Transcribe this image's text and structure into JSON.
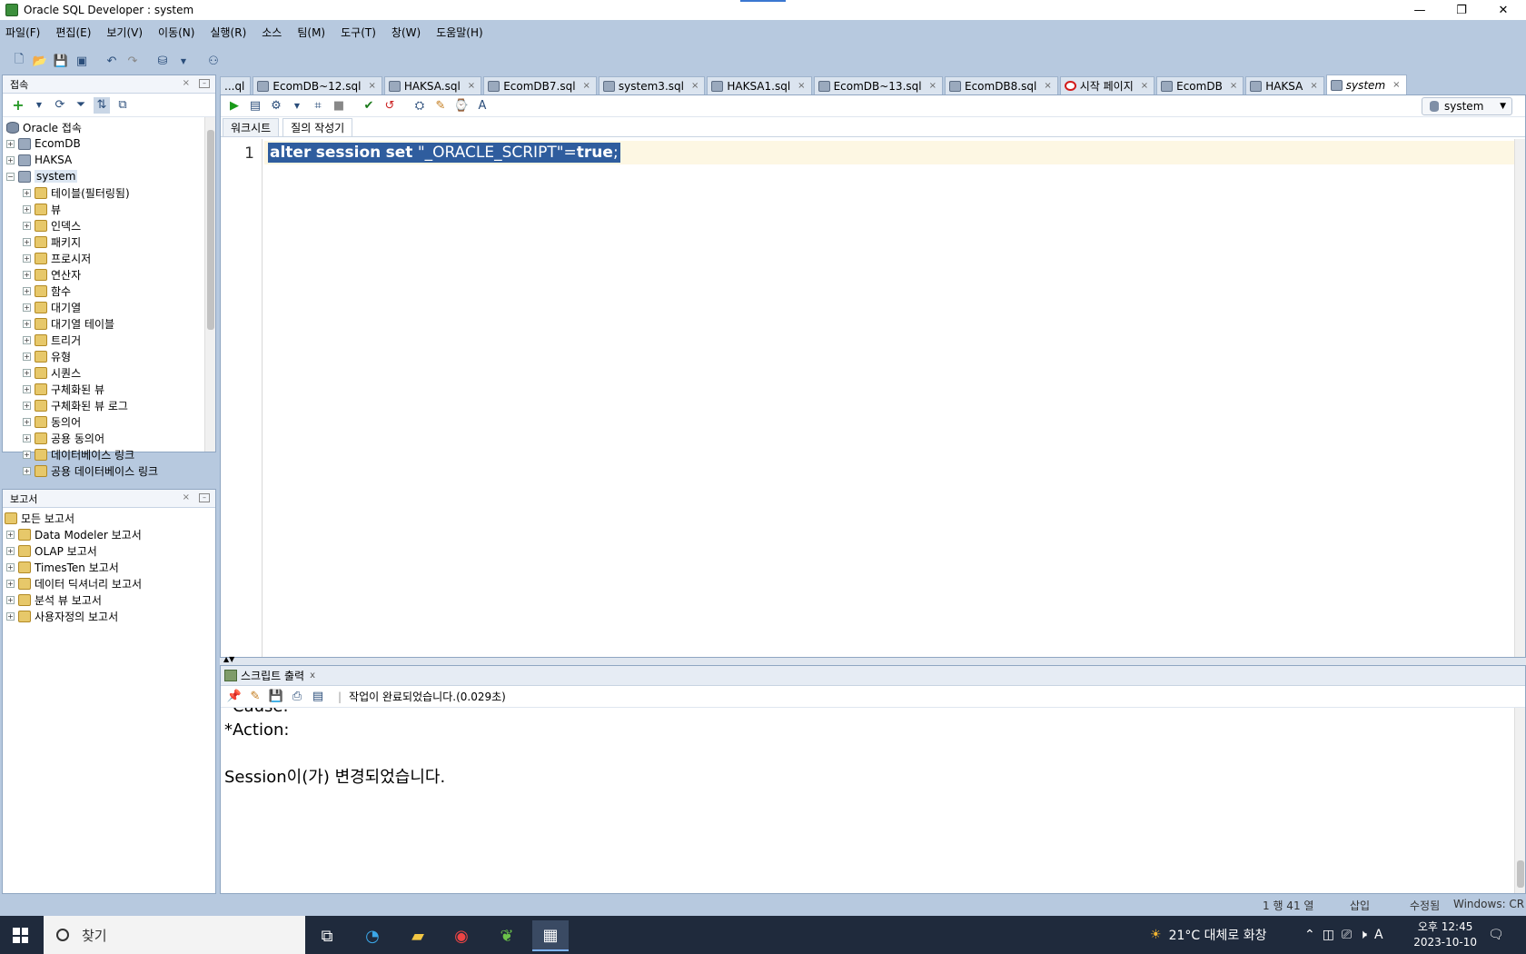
{
  "window": {
    "title": "Oracle SQL Developer : system",
    "controls": {
      "minimize": "—",
      "maximize": "❐",
      "close": "✕"
    }
  },
  "menu": [
    "파일(F)",
    "편집(E)",
    "보기(V)",
    "이동(N)",
    "실행(R)",
    "소스",
    "팀(M)",
    "도구(T)",
    "창(W)",
    "도움말(H)"
  ],
  "connections_panel": {
    "title": "접속",
    "root": "Oracle 접속",
    "items": [
      "EcomDB",
      "HAKSA",
      "system"
    ],
    "system_children": [
      "테이블(필터링됨)",
      "뷰",
      "인덱스",
      "패키지",
      "프로시저",
      "연산자",
      "함수",
      "대기열",
      "대기열 테이블",
      "트리거",
      "유형",
      "시퀀스",
      "구체화된 뷰",
      "구체화된 뷰 로그",
      "동의어",
      "공용 동의어",
      "데이터베이스 링크",
      "공용 데이터베이스 링크"
    ]
  },
  "reports_panel": {
    "title": "보고서",
    "root": "모든 보고서",
    "items": [
      "Data Modeler 보고서",
      "OLAP 보고서",
      "TimesTen 보고서",
      "데이터 딕셔너리 보고서",
      "분석 뷰 보고서",
      "사용자정의 보고서"
    ]
  },
  "editor_tabs": [
    "...ql",
    "EcomDB~12.sql",
    "HAKSA.sql",
    "EcomDB7.sql",
    "system3.sql",
    "HAKSA1.sql",
    "EcomDB~13.sql",
    "EcomDB8.sql",
    "시작 페이지",
    "EcomDB",
    "HAKSA",
    "system"
  ],
  "editor": {
    "connection": "system",
    "subtabs": [
      "워크시트",
      "질의 작성기"
    ],
    "line_number": "1",
    "code": {
      "alter": "alter",
      "session": "session",
      "set": "set",
      "string": "\"_ORACLE_SCRIPT\"",
      "eq": "=",
      "value": "true",
      "semi": ";"
    }
  },
  "output": {
    "tab": "스크립트 출력",
    "close": "x",
    "status": "작업이 완료되었습니다.(0.029초)",
    "lines": [
      "*Cause:",
      "*Action:",
      "",
      "Session이(가) 변경되었습니다."
    ]
  },
  "statusbar": {
    "position": "1 행 41 열",
    "mode": "삽입",
    "modified": "수정됨",
    "eol": "Windows: CR"
  },
  "taskbar": {
    "search_placeholder": "찾기",
    "weather": "21°C  대체로 화창",
    "time": "오후 12:45",
    "date": "2023-10-10",
    "ime": "A"
  }
}
